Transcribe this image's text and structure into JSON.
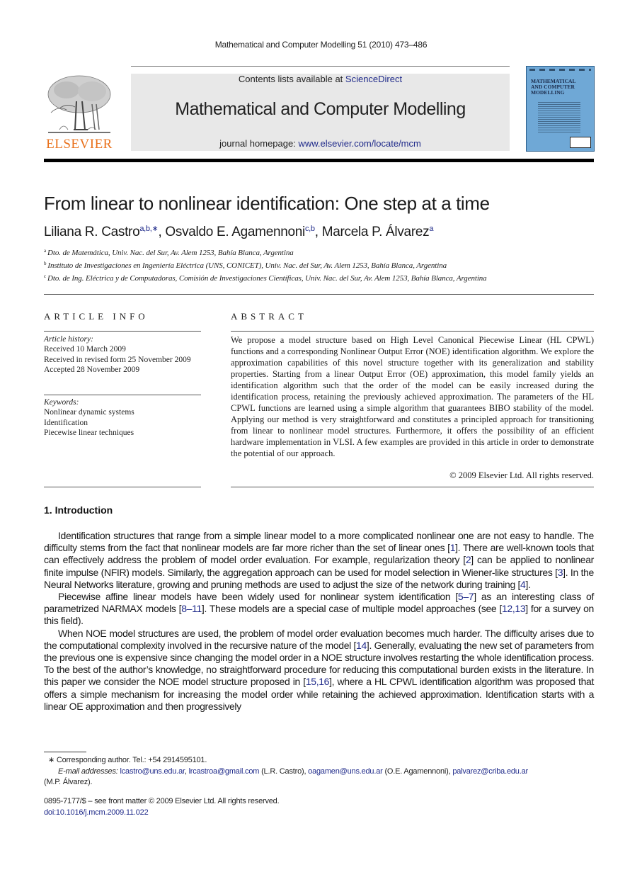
{
  "running_header": "Mathematical and Computer Modelling 51 (2010) 473–486",
  "masthead": {
    "publisher": "ELSEVIER",
    "contents_prefix": "Contents lists available at ",
    "contents_link": "ScienceDirect",
    "journal_title": "Mathematical and Computer Modelling",
    "homepage_prefix": "journal homepage: ",
    "homepage_link": "www.elsevier.com/locate/mcm",
    "cover_title": "MATHEMATICAL\nAND COMPUTER\nMODELLING",
    "colors": {
      "publisher_orange": "#e9711c",
      "link_blue": "#1f2a8a",
      "cover_blue": "#6fa8d6",
      "masthead_gray": "#e8e8e8"
    }
  },
  "article": {
    "title": "From linear to nonlinear identification: One step at a time",
    "authors": [
      {
        "name": "Liliana R. Castro",
        "marks": "a,b,∗",
        "sep": ", "
      },
      {
        "name": "Osvaldo E. Agamennoni",
        "marks": "c,b",
        "sep": ", "
      },
      {
        "name": "Marcela P. Álvarez",
        "marks": "a",
        "sep": ""
      }
    ],
    "affiliations": [
      {
        "mark": "a",
        "text": "Dto. de Matemática, Univ. Nac. del Sur, Av. Alem 1253, Bahía Blanca, Argentina"
      },
      {
        "mark": "b",
        "text": "Instituto de Investigaciones en Ingeniería Eléctrica (UNS, CONICET), Univ. Nac. del Sur, Av. Alem 1253, Bahía Blanca, Argentina"
      },
      {
        "mark": "c",
        "text": "Dto. de Ing. Eléctrica y de Computadoras, Comisión de Investigaciones Científicas, Univ. Nac. del Sur, Av. Alem 1253, Bahía Blanca, Argentina"
      }
    ]
  },
  "article_info": {
    "heading": "ARTICLE INFO",
    "history_label": "Article history:",
    "history": [
      "Received 10 March 2009",
      "Received in revised form 25 November 2009",
      "Accepted 28 November 2009"
    ],
    "keywords_label": "Keywords:",
    "keywords": [
      "Nonlinear dynamic systems",
      "Identification",
      "Piecewise linear techniques"
    ]
  },
  "abstract": {
    "heading": "ABSTRACT",
    "text": "We propose a model structure based on High Level Canonical Piecewise Linear (HL CPWL) functions and a corresponding Nonlinear Output Error (NOE) identification algorithm. We explore the approximation capabilities of this novel structure together with its generalization and stability properties. Starting from a linear Output Error (OE) approximation, this model family yields an identification algorithm such that the order of the model can be easily increased during the identification process, retaining the previously achieved approximation. The parameters of the HL CPWL functions are learned using a simple algorithm that guarantees BIBO stability of the model. Applying our method is very straightforward and constitutes a principled approach for transitioning from linear to nonlinear model structures. Furthermore, it offers the possibility of an efficient hardware implementation in VLSI. A few examples are provided in this article in order to demonstrate the potential of our approach.",
    "copyright": "© 2009 Elsevier Ltd. All rights reserved."
  },
  "introduction": {
    "heading": "1.  Introduction",
    "paragraphs": [
      [
        {
          "t": "Identification structures that range from a simple linear model to a more complicated nonlinear one are not easy to handle. The difficulty stems from the fact that nonlinear models are far more richer than the set of linear ones ["
        },
        {
          "ref": "1"
        },
        {
          "t": "]. There are well-known tools that can effectively address the problem of model order evaluation. For example, regularization theory ["
        },
        {
          "ref": "2"
        },
        {
          "t": "] can be applied to nonlinear finite impulse (NFIR) models. Similarly, the aggregation approach can be used for model selection in Wiener-like structures ["
        },
        {
          "ref": "3"
        },
        {
          "t": "]. In the Neural Networks literature, growing and pruning methods are used to adjust the size of the network during training ["
        },
        {
          "ref": "4"
        },
        {
          "t": "]."
        }
      ],
      [
        {
          "t": "Piecewise affine linear models have been widely used for nonlinear system identification ["
        },
        {
          "ref": "5–7"
        },
        {
          "t": "] as an interesting class of parametrized NARMAX models ["
        },
        {
          "ref": "8–11"
        },
        {
          "t": "]. These models are a special case of multiple model approaches (see ["
        },
        {
          "ref": "12,13"
        },
        {
          "t": "] for a survey on this field)."
        }
      ],
      [
        {
          "t": "When NOE model structures are used, the problem of model order evaluation becomes much harder. The difficulty arises due to the computational complexity involved in the recursive nature of the model ["
        },
        {
          "ref": "14"
        },
        {
          "t": "]. Generally, evaluating the new set of parameters from the previous one is expensive since changing the model order in a NOE structure involves restarting the whole identification process. To the best of the author’s knowledge, no straightforward procedure for reducing this computational burden exists in the literature. In this paper we consider the NOE model structure proposed in ["
        },
        {
          "ref": "15,16"
        },
        {
          "t": "], where a HL CPWL identification algorithm was proposed that offers a simple mechanism for increasing the model order while retaining the achieved approximation. Identification starts with a linear OE approximation and then progressively"
        }
      ]
    ]
  },
  "footnotes": {
    "corresponding_mark": "∗",
    "corresponding": "Corresponding author. Tel.: +54 2914595101.",
    "email_label": "E-mail addresses:",
    "emails": [
      {
        "addr": "lcastro@uns.edu.ar",
        "after": ", "
      },
      {
        "addr": "lrcastroa@gmail.com",
        "after": " (L.R. Castro), "
      },
      {
        "addr": "oagamen@uns.edu.ar",
        "after": " (O.E. Agamennoni), "
      },
      {
        "addr": "palvarez@criba.edu.ar",
        "after": ""
      }
    ],
    "email_tail": "(M.P. Álvarez)."
  },
  "bottom": {
    "issn_line": "0895-7177/$ – see front matter © 2009 Elsevier Ltd. All rights reserved.",
    "doi": "doi:10.1016/j.mcm.2009.11.022"
  }
}
